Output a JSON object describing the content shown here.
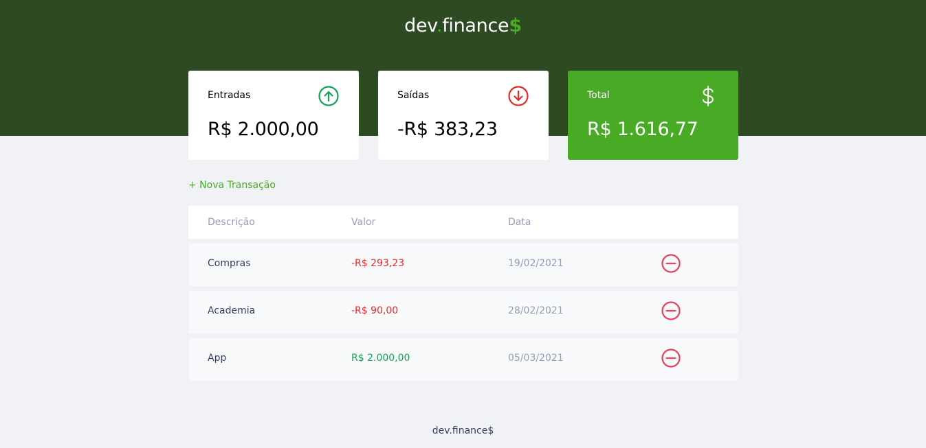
{
  "header": {
    "logo_prefix": "dev",
    "logo_dot": ".",
    "logo_name": "finance",
    "logo_dollar": "$"
  },
  "cards": {
    "income": {
      "label": "Entradas",
      "value": "R$ 2.000,00",
      "icon": "arrow-up-circle-icon"
    },
    "expense": {
      "label": "Saídas",
      "value": "-R$ 383,23",
      "icon": "arrow-down-circle-icon"
    },
    "total": {
      "label": "Total",
      "value": "R$ 1.616,77",
      "icon": "dollar-icon"
    }
  },
  "actions": {
    "new_transaction": "+ Nova Transação"
  },
  "table": {
    "headers": [
      "Descrição",
      "Valor",
      "Data"
    ],
    "rows": [
      {
        "description": "Compras",
        "amount": "-R$ 293,23",
        "date": "19/02/2021",
        "type": "expense"
      },
      {
        "description": "Academia",
        "amount": "-R$ 90,00",
        "date": "28/02/2021",
        "type": "expense"
      },
      {
        "description": "App",
        "amount": "R$ 2.000,00",
        "date": "05/03/2021",
        "type": "income"
      }
    ]
  },
  "footer": {
    "text": "dev.finance$"
  },
  "colors": {
    "header_bg": "#2d4a22",
    "accent_green": "#49aa26",
    "income_green": "#12a454",
    "expense_red": "#e92929",
    "page_bg": "#f0f2f5"
  }
}
